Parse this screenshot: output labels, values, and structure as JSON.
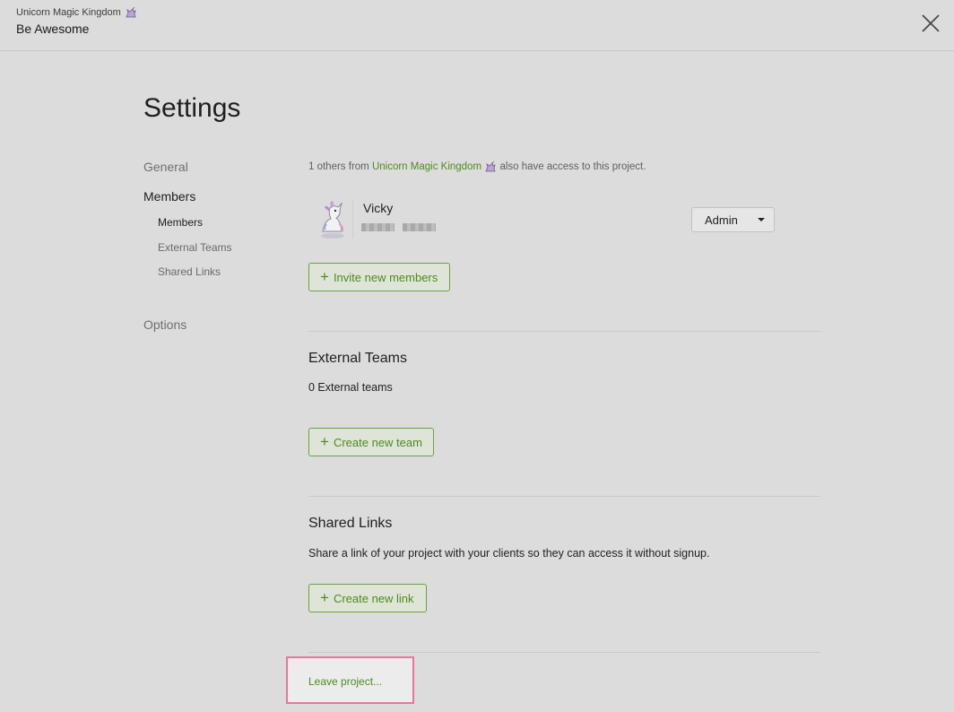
{
  "header": {
    "org_name": "Unicorn Magic Kingdom",
    "project_name": "Be Awesome",
    "close_icon": "close-icon"
  },
  "page": {
    "title": "Settings"
  },
  "sidebar": {
    "general": "General",
    "members": "Members",
    "sub_items": [
      "Members",
      "External Teams",
      "Shared Links"
    ],
    "options": "Options"
  },
  "members": {
    "note_prefix": "1 others from",
    "note_org": "Unicorn Magic Kingdom",
    "note_suffix": "also have access to this project.",
    "member_name": "Vicky",
    "role": "Admin",
    "invite_label": "Invite new members"
  },
  "external_teams": {
    "title": "External Teams",
    "count_text": "0 External teams",
    "create_label": "Create new team"
  },
  "shared_links": {
    "title": "Shared Links",
    "description": "Share a link of your project with your clients so they can access it without signup.",
    "create_label": "Create new link"
  },
  "leave": {
    "label": "Leave project..."
  },
  "colors": {
    "accent_green": "#4e8a1f",
    "highlight_pink": "#e8769b",
    "background": "#dcdcdc"
  }
}
